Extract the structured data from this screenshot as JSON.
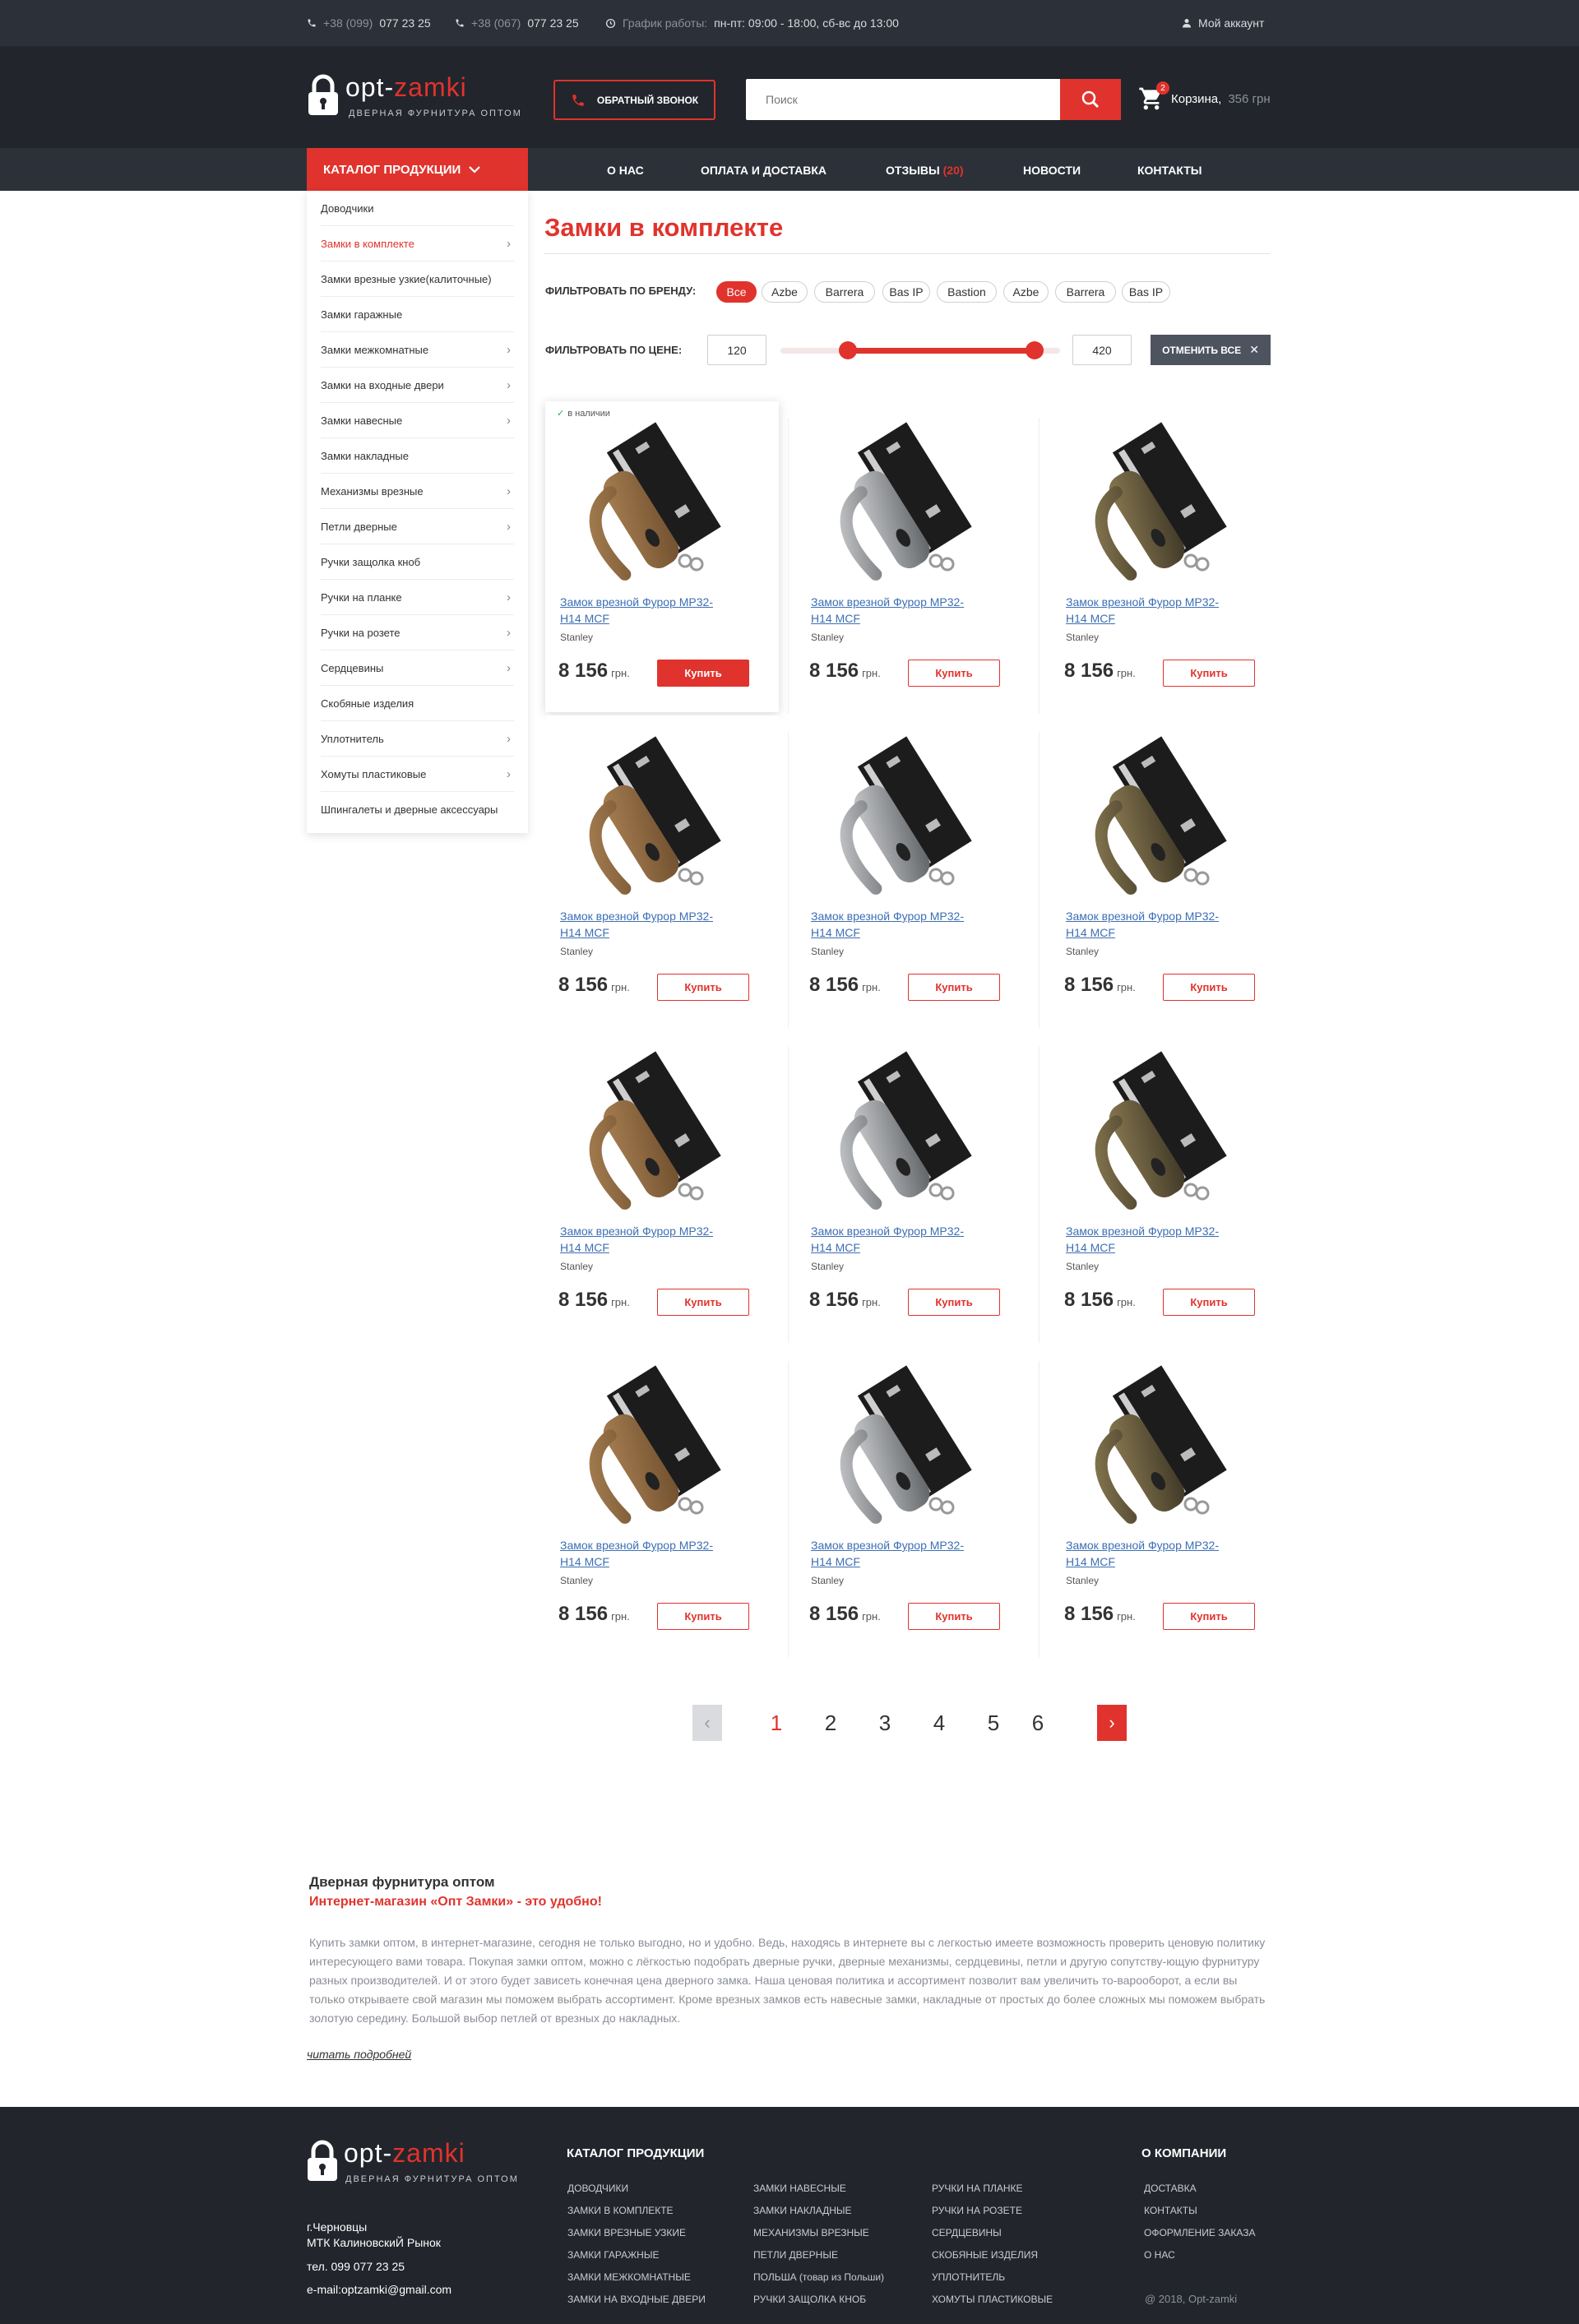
{
  "topbar": {
    "phone1_prefix": "+38 (099)",
    "phone1_number": "077 23 25",
    "phone2_prefix": "+38 (067)",
    "phone2_number": "077 23 25",
    "schedule_label": "График работы:",
    "schedule_value": "пн-пт: 09:00 - 18:00, сб-вс до 13:00",
    "account": "Мой аккаунт"
  },
  "header": {
    "logo_main": "opt-",
    "logo_accent": "zamki",
    "logo_sub": "ДВЕРНАЯ ФУРНИТУРА ОПТОМ",
    "callback": "ОБРАТНЫЙ ЗВОНОК",
    "search_placeholder": "Поиск",
    "cart_count": "2",
    "cart_label": "Корзина,",
    "cart_sum": "356 грн"
  },
  "nav": {
    "catalog": "КАТАЛОГ ПРОДУКЦИИ",
    "items": [
      {
        "label": "О НАС"
      },
      {
        "label": "ОПЛАТА И ДОСТАВКА"
      },
      {
        "label": "ОТЗЫВЫ",
        "count": "(20)"
      },
      {
        "label": "НОВОСТИ"
      },
      {
        "label": "КОНТАКТЫ"
      }
    ]
  },
  "sidebar": {
    "items": [
      {
        "label": "Доводчики",
        "arrow": ""
      },
      {
        "label": "Замки в комплекте",
        "arrow": "›",
        "active": true
      },
      {
        "label": "Замки врезные узкие(калиточные)",
        "arrow": ""
      },
      {
        "label": "Замки гаражные",
        "arrow": ""
      },
      {
        "label": "Замки межкомнатные",
        "arrow": "›"
      },
      {
        "label": "Замки на входные двери",
        "arrow": "›"
      },
      {
        "label": "Замки навесные",
        "arrow": "›"
      },
      {
        "label": "Замки накладные",
        "arrow": ""
      },
      {
        "label": "Механизмы врезные",
        "arrow": "›"
      },
      {
        "label": "Петли дверные",
        "arrow": "›"
      },
      {
        "label": "Ручки защолка кноб",
        "arrow": ""
      },
      {
        "label": "Ручки на планке",
        "arrow": "›"
      },
      {
        "label": "Ручки на розете",
        "arrow": "›"
      },
      {
        "label": "Сердцевины",
        "arrow": "›"
      },
      {
        "label": "Скобяные изделия",
        "arrow": ""
      },
      {
        "label": "Уплотнитель",
        "arrow": "›"
      },
      {
        "label": "Хомуты пластиковые",
        "arrow": "›"
      },
      {
        "label": "Шпингалеты и дверные аксессуары",
        "arrow": ""
      }
    ]
  },
  "main": {
    "title": "Замки в комплекте",
    "brand_filter_label": "ФИЛЬТРОВАТЬ ПО БРЕНДУ:",
    "brands": [
      "Все",
      "Azbe",
      "Barrera",
      "Bas IP",
      "Bastion",
      "Azbe",
      "Barrera",
      "Bas IP"
    ],
    "price_filter_label": "ФИЛЬТРОВАТЬ ПО ЦЕНЕ:",
    "price_min": "120",
    "price_max": "420",
    "price_range_low_fraction": 0.24,
    "price_range_high_fraction": 0.91,
    "reset": "ОТМЕНИТЬ ВСЕ",
    "in_stock": "в наличии",
    "products": [
      {
        "name": "Замок врезной Фурор MP32-H14 MCF",
        "brand": "Stanley",
        "price": "8 156",
        "currency": "грн.",
        "buy": "Купить",
        "finish": "bronze"
      },
      {
        "name": "Замок врезной Фурор MP32-H14 MCF",
        "brand": "Stanley",
        "price": "8 156",
        "currency": "грн.",
        "buy": "Купить",
        "finish": "chrome"
      },
      {
        "name": "Замок врезной Фурор MP32-H14 MCF",
        "brand": "Stanley",
        "price": "8 156",
        "currency": "грн.",
        "buy": "Купить",
        "finish": "antique"
      },
      {
        "name": "Замок врезной Фурор MP32-H14 MCF",
        "brand": "Stanley",
        "price": "8 156",
        "currency": "грн.",
        "buy": "Купить",
        "finish": "bronze"
      },
      {
        "name": "Замок врезной Фурор MP32-H14 MCF",
        "brand": "Stanley",
        "price": "8 156",
        "currency": "грн.",
        "buy": "Купить",
        "finish": "chrome"
      },
      {
        "name": "Замок врезной Фурор MP32-H14 MCF",
        "brand": "Stanley",
        "price": "8 156",
        "currency": "грн.",
        "buy": "Купить",
        "finish": "antique"
      },
      {
        "name": "Замок врезной Фурор MP32-H14 MCF",
        "brand": "Stanley",
        "price": "8 156",
        "currency": "грн.",
        "buy": "Купить",
        "finish": "bronze"
      },
      {
        "name": "Замок врезной Фурор MP32-H14 MCF",
        "brand": "Stanley",
        "price": "8 156",
        "currency": "грн.",
        "buy": "Купить",
        "finish": "chrome"
      },
      {
        "name": "Замок врезной Фурор MP32-H14 MCF",
        "brand": "Stanley",
        "price": "8 156",
        "currency": "грн.",
        "buy": "Купить",
        "finish": "antique"
      },
      {
        "name": "Замок врезной Фурор MP32-H14 MCF",
        "brand": "Stanley",
        "price": "8 156",
        "currency": "грн.",
        "buy": "Купить",
        "finish": "bronze"
      },
      {
        "name": "Замок врезной Фурор MP32-H14 MCF",
        "brand": "Stanley",
        "price": "8 156",
        "currency": "грн.",
        "buy": "Купить",
        "finish": "chrome"
      },
      {
        "name": "Замок врезной Фурор MP32-H14 MCF",
        "brand": "Stanley",
        "price": "8 156",
        "currency": "грн.",
        "buy": "Купить",
        "finish": "antique"
      }
    ]
  },
  "pagination": {
    "pages": [
      "1",
      "2",
      "3",
      "4",
      "5",
      "6"
    ],
    "current": "1"
  },
  "seo": {
    "title": "Дверная фурнитура оптом",
    "subtitle": "Интернет-магазин «Опт Замки» - это удобно!",
    "text": "Купить замки оптом, в интернет-магазине, сегодня не только выгодно, но и удобно. Ведь, находясь в интернете вы с легкостью имеете возможность проверить ценовую политику интересующего вами товара. Покупая замки оптом, можно с лёгкостью подобрать дверные ручки, дверные механизмы, сердцевины, петли и другую сопутству-ющую фурнитуру разных производителей. И от этого будет зависеть конечная цена дверного замка. Наша ценовая политика и ассортимент позволит вам увеличить то-варооборот, а если вы только открываете свой магазин мы поможем выбрать ассортимент. Кроме врезных замков есть навесные замки, накладные от простых до более сложных мы поможем выбрать золотую середину. Большой выбор петлей от врезных до накладных.",
    "more": "читать подробней"
  },
  "footer": {
    "catalog_title": "КАТАЛОГ ПРОДУКЦИИ",
    "col1": [
      "ДОВОДЧИКИ",
      "ЗАМКИ В КОМПЛЕКТЕ",
      "ЗАМКИ ВРЕЗНЫЕ УЗКИЕ",
      "ЗАМКИ ГАРАЖНЫЕ",
      "ЗАМКИ МЕЖКОМНАТНЫЕ",
      "ЗАМКИ НА ВХОДНЫЕ ДВЕРИ"
    ],
    "col2": [
      "ЗАМКИ НАВЕСНЫЕ",
      "ЗАМКИ НАКЛАДНЫЕ",
      "МЕХАНИЗМЫ ВРЕЗНЫЕ",
      "ПЕТЛИ ДВЕРНЫЕ",
      "ПОЛЬША (товар из Польши)",
      "РУЧКИ ЗАЩОЛКА КНОБ"
    ],
    "col3": [
      "РУЧКИ НА ПЛАНКЕ",
      "РУЧКИ НА РОЗЕТЕ",
      "СЕРДЦЕВИНЫ",
      "СКОБЯНЫЕ ИЗДЕЛИЯ",
      "УПЛОТНИТЕЛЬ",
      "ХОМУТЫ ПЛАСТИКОВЫЕ"
    ],
    "company_title": "О КОМПАНИИ",
    "company": [
      "ДОСТАВКА",
      "КОНТАКТЫ",
      "ОФОРМЛЕНИЕ ЗАКАЗА",
      "О НАС"
    ],
    "city": "г.Черновцы",
    "market": "МТК КалиновскиЙ Рынок",
    "phone": "тел. 099 077 23 25",
    "email": "e-mail:optzamki@gmail.com",
    "copyright": "@ 2018, Opt-zamki"
  },
  "colors": {
    "accent": "#e0332d",
    "dark": "#22252c",
    "bar": "#2c3039",
    "link": "#3d6fb4"
  }
}
